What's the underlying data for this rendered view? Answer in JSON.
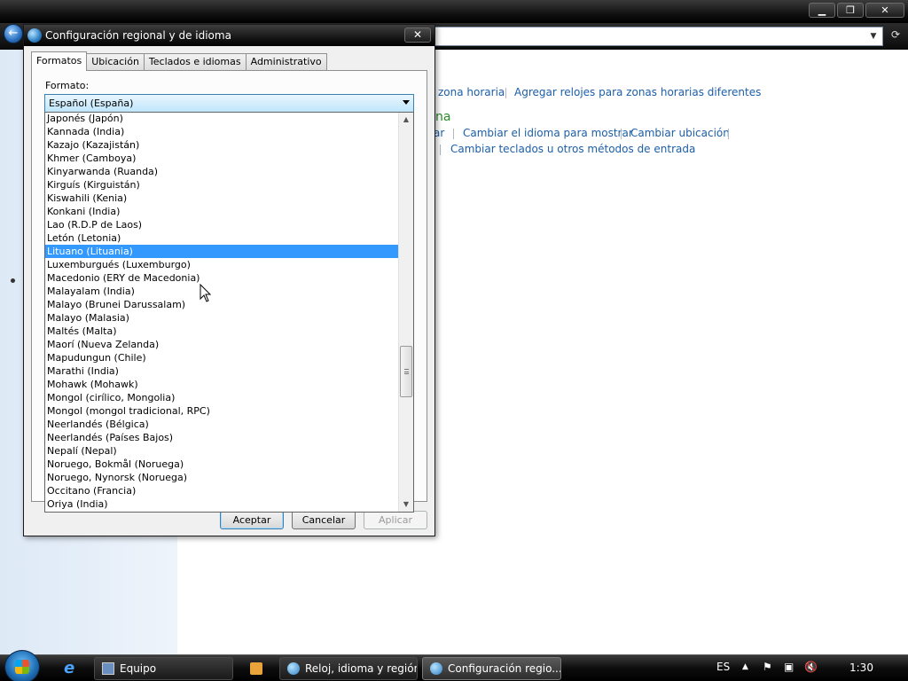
{
  "control_panel": {
    "links": {
      "zona_horaria": "zona horaria",
      "agregar_relojes": "Agregar relojes para zonas horarias diferentes",
      "cambiar_idioma_mostrar": "Cambiar el idioma para mostrar",
      "cambiar_ubicacion": "Cambiar ubicación",
      "cambiar_teclados": "Cambiar teclados u otros métodos de entrada",
      "ar_fragment": "ar"
    },
    "heading_fragment": "na"
  },
  "window_buttons": {
    "minimize": "▁",
    "restore": "❐",
    "close": "✕"
  },
  "dialog": {
    "title": "Configuración regional y de idioma",
    "close": "✕",
    "back": "←",
    "tabs": [
      "Formatos",
      "Ubicación",
      "Teclados e idiomas",
      "Administrativo"
    ],
    "active_tab": "Formatos",
    "format_label": "Formato:",
    "format_value": "Español (España)",
    "options": [
      "Japonés (Japón)",
      "Kannada (India)",
      "Kazajo (Kazajistán)",
      "Khmer (Camboya)",
      "Kinyarwanda (Ruanda)",
      "Kirguís (Kirguistán)",
      "Kiswahili (Kenia)",
      "Konkani (India)",
      "Lao (R.D.P de Laos)",
      "Letón (Letonia)",
      "Lituano (Lituania)",
      "Luxemburgués (Luxemburgo)",
      "Macedonio (ERY de Macedonia)",
      "Malayalam (India)",
      "Malayo (Brunei Darussalam)",
      "Malayo (Malasia)",
      "Maltés (Malta)",
      "Maorí (Nueva Zelanda)",
      "Mapudungun (Chile)",
      "Marathi (India)",
      "Mohawk (Mohawk)",
      "Mongol (cirílico, Mongolia)",
      "Mongol (mongol tradicional, RPC)",
      "Neerlandés (Bélgica)",
      "Neerlandés (Países Bajos)",
      "Nepalí (Nepal)",
      "Noruego, Bokmål (Noruega)",
      "Noruego, Nynorsk (Noruega)",
      "Occitano (Francia)",
      "Oriya (India)"
    ],
    "selected_index": 10,
    "buttons": {
      "accept": "Aceptar",
      "cancel": "Cancelar",
      "apply": "Aplicar"
    }
  },
  "taskbar": {
    "tasks": [
      {
        "label": "Equipo",
        "icon": "computer-icon"
      },
      {
        "label": "Reloj, idioma y región",
        "icon": "globe-icon"
      },
      {
        "label": "Configuración regio...",
        "icon": "globe-icon"
      }
    ],
    "tray": {
      "language": "ES",
      "clock": "1:30"
    }
  },
  "colors": {
    "selection": "#3399ff",
    "link": "#1c5ea8",
    "heading": "#2a8a2a"
  }
}
